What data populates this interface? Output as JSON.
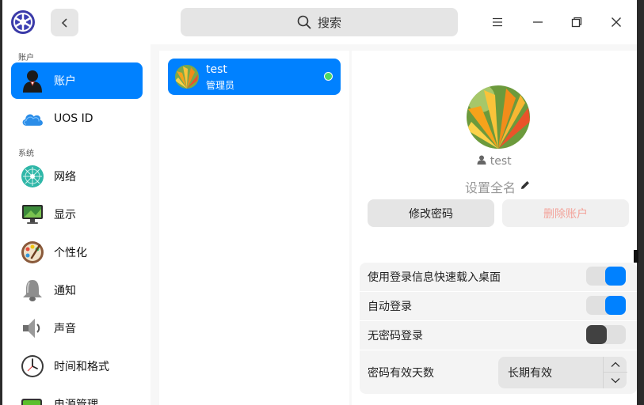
{
  "window": {
    "search_label": "搜索"
  },
  "sidebar": {
    "sections": [
      {
        "label": "账户"
      },
      {
        "label": "系统"
      }
    ],
    "items": [
      {
        "label": "账户",
        "icon": "user-icon",
        "active": true
      },
      {
        "label": "UOS ID",
        "icon": "cloud-icon"
      },
      {
        "label": "网络",
        "icon": "network-icon"
      },
      {
        "label": "显示",
        "icon": "display-icon"
      },
      {
        "label": "个性化",
        "icon": "palette-icon"
      },
      {
        "label": "通知",
        "icon": "bell-icon"
      },
      {
        "label": "声音",
        "icon": "speaker-icon"
      },
      {
        "label": "时间和格式",
        "icon": "clock-icon"
      },
      {
        "label": "电源管理",
        "icon": "battery-icon"
      }
    ]
  },
  "users": [
    {
      "name": "test",
      "role": "管理员",
      "online": true
    }
  ],
  "detail": {
    "username": "test",
    "fullname_placeholder": "设置全名",
    "change_password": "修改密码",
    "delete_account": "删除账户",
    "options": [
      {
        "label": "使用登录信息快速载入桌面",
        "enabled": true
      },
      {
        "label": "自动登录",
        "enabled": true
      },
      {
        "label": "无密码登录",
        "enabled": false
      }
    ],
    "password_validity": {
      "label": "密码有效天数",
      "value": "长期有效"
    }
  },
  "colors": {
    "accent": "#0081ff",
    "delete_text": "#f3a39a",
    "online": "#4cd964"
  }
}
